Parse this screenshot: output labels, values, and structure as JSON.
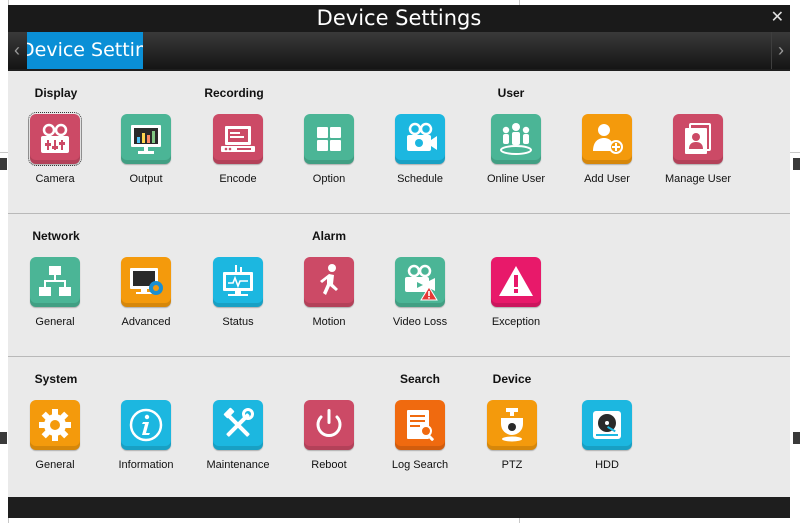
{
  "window": {
    "title": "Device Settings",
    "close_glyph": "✕"
  },
  "tabbar": {
    "left_arrow": "‹",
    "right_arrow": "›",
    "active_tab": "Device Setting"
  },
  "colors": {
    "tab_active": "#0a8fd6",
    "content_bg": "#eaeaea",
    "window_bg": "#1e1e1e"
  },
  "sections": [
    {
      "labels": [
        "Display",
        "Recording",
        "User"
      ],
      "items": [
        {
          "label": "Camera",
          "icon": "camera-settings-icon",
          "color": "#cc4a66"
        },
        {
          "label": "Output",
          "icon": "monitor-chart-icon",
          "color": "#4bb596"
        },
        {
          "label": "Encode",
          "icon": "encode-device-icon",
          "color": "#cc4a66"
        },
        {
          "label": "Option",
          "icon": "grid-options-icon",
          "color": "#4bb596"
        },
        {
          "label": "Schedule",
          "icon": "video-schedule-icon",
          "color": "#1cb7e0"
        },
        {
          "label": "Online User",
          "icon": "online-users-icon",
          "color": "#4bb596"
        },
        {
          "label": "Add User",
          "icon": "add-user-icon",
          "color": "#f49a0c"
        },
        {
          "label": "Manage User",
          "icon": "manage-user-icon",
          "color": "#cc4a66"
        }
      ]
    },
    {
      "labels": [
        "Network",
        "Alarm"
      ],
      "items": [
        {
          "label": "General",
          "icon": "network-topology-icon",
          "color": "#4bb596"
        },
        {
          "label": "Advanced",
          "icon": "monitor-gear-icon",
          "color": "#f49a0c"
        },
        {
          "label": "Status",
          "icon": "network-status-icon",
          "color": "#1cb7e0"
        },
        {
          "label": "Motion",
          "icon": "motion-person-icon",
          "color": "#cc4a66"
        },
        {
          "label": "Video Loss",
          "icon": "video-loss-icon",
          "color": "#4bb596"
        },
        {
          "label": "Exception",
          "icon": "warning-triangle-icon",
          "color": "#e8196a"
        }
      ]
    },
    {
      "labels": [
        "System",
        "Search",
        "Device"
      ],
      "items": [
        {
          "label": "General",
          "icon": "gear-icon",
          "color": "#f49a0c"
        },
        {
          "label": "Information",
          "icon": "info-icon",
          "color": "#1cb7e0"
        },
        {
          "label": "Maintenance",
          "icon": "wrench-hammer-icon",
          "color": "#1cb7e0"
        },
        {
          "label": "Reboot",
          "icon": "power-icon",
          "color": "#cc4a66"
        },
        {
          "label": "Log Search",
          "icon": "log-search-icon",
          "color": "#f06a0f"
        },
        {
          "label": "PTZ",
          "icon": "ptz-dome-camera-icon",
          "color": "#f49a0c"
        },
        {
          "label": "HDD",
          "icon": "hard-disk-icon",
          "color": "#1cb7e0"
        }
      ]
    }
  ]
}
